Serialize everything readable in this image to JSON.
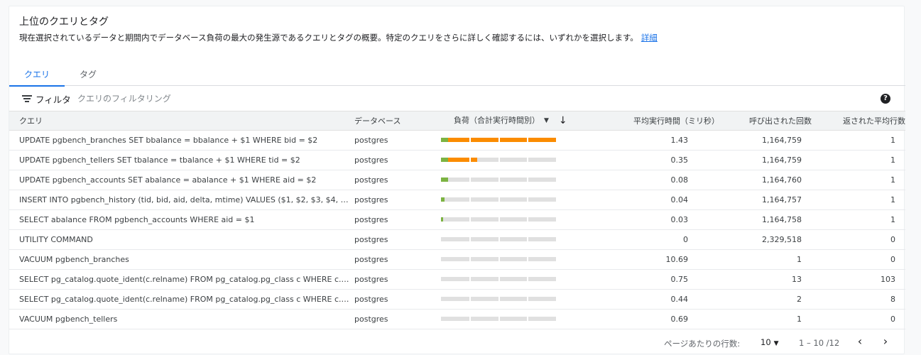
{
  "header": {
    "title": "上位のクエリとタグ",
    "description": "現在選択されているデータと期間内でデータベース負荷の最大の発生源であるクエリとタグの概要。特定のクエリをさらに詳しく確認するには、いずれかを選択します。",
    "details_link": "詳細"
  },
  "tabs": [
    {
      "label": "クエリ",
      "active": true
    },
    {
      "label": "タグ",
      "active": false
    }
  ],
  "filter": {
    "label": "フィルタ",
    "placeholder": "クエリのフィルタリング"
  },
  "help_icon": "?",
  "table": {
    "columns": {
      "query": "クエリ",
      "database": "データベース",
      "load": "負荷（合計実行時間別）",
      "avg_time": "平均実行時間（ミリ秒）",
      "calls": "呼び出された回数",
      "avg_rows": "返された平均行数"
    },
    "rows": [
      {
        "query": "UPDATE pgbench_branches SET bbalance = bbalance + $1 WHERE bid = $2",
        "database": "postgres",
        "load_green": 0.06,
        "load_orange": 1.0,
        "avg_time": "1.43",
        "calls": "1,164,759",
        "avg_rows": "1"
      },
      {
        "query": "UPDATE pgbench_tellers SET tbalance = tbalance + $1 WHERE tid = $2",
        "database": "postgres",
        "load_green": 0.06,
        "load_orange": 0.25,
        "avg_time": "0.35",
        "calls": "1,164,759",
        "avg_rows": "1"
      },
      {
        "query": "UPDATE pgbench_accounts SET abalance = abalance + $1 WHERE aid = $2",
        "database": "postgres",
        "load_green": 0.06,
        "load_orange": 0.0,
        "avg_time": "0.08",
        "calls": "1,164,760",
        "avg_rows": "1"
      },
      {
        "query": "INSERT INTO pgbench_history (tid, bid, aid, delta, mtime) VALUES ($1, $2, $3, $4, CUR...",
        "database": "postgres",
        "load_green": 0.03,
        "load_orange": 0.0,
        "avg_time": "0.04",
        "calls": "1,164,757",
        "avg_rows": "1"
      },
      {
        "query": "SELECT abalance FROM pgbench_accounts WHERE aid = $1",
        "database": "postgres",
        "load_green": 0.02,
        "load_orange": 0.0,
        "avg_time": "0.03",
        "calls": "1,164,758",
        "avg_rows": "1"
      },
      {
        "query": "UTILITY COMMAND",
        "database": "postgres",
        "load_green": 0.0,
        "load_orange": 0.0,
        "avg_time": "0",
        "calls": "2,329,518",
        "avg_rows": "0"
      },
      {
        "query": "VACUUM pgbench_branches",
        "database": "postgres",
        "load_green": 0.0,
        "load_orange": 0.0,
        "avg_time": "10.69",
        "calls": "1",
        "avg_rows": "0"
      },
      {
        "query": "SELECT pg_catalog.quote_ident(c.relname) FROM pg_catalog.pg_class c WHERE c.r...",
        "database": "postgres",
        "load_green": 0.0,
        "load_orange": 0.0,
        "avg_time": "0.75",
        "calls": "13",
        "avg_rows": "103"
      },
      {
        "query": "SELECT pg_catalog.quote_ident(c.relname) FROM pg_catalog.pg_class c WHERE c.r...",
        "database": "postgres",
        "load_green": 0.0,
        "load_orange": 0.0,
        "avg_time": "0.44",
        "calls": "2",
        "avg_rows": "8"
      },
      {
        "query": "VACUUM pgbench_tellers",
        "database": "postgres",
        "load_green": 0.0,
        "load_orange": 0.0,
        "avg_time": "0.69",
        "calls": "1",
        "avg_rows": "0"
      }
    ]
  },
  "footer": {
    "rows_per_page_label": "ページあたりの行数:",
    "rows_per_page_value": "10",
    "range": "1 – 10 /12",
    "prev_icon": "chevron-left-icon",
    "next_icon": "chevron-right-icon"
  },
  "colors": {
    "accent": "#1a73e8",
    "bar_green": "#7cb342",
    "bar_orange": "#fb8c00",
    "bar_track": "#e0e0e0"
  }
}
